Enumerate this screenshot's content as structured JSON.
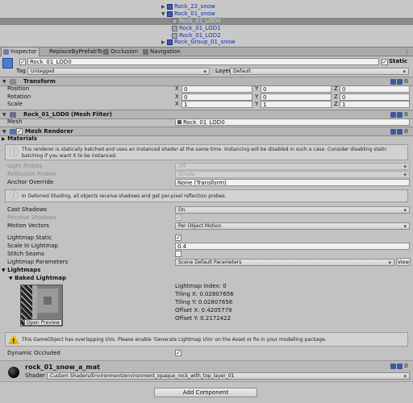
{
  "hierarchy": {
    "items": [
      {
        "label": "Rock_22_snow",
        "expanded": false,
        "selected": false
      },
      {
        "label": "Rock_01_snow",
        "expanded": true,
        "selected": false
      },
      {
        "label": "Rock_01_LOD0",
        "selected": true
      },
      {
        "label": "Rock_01_LOD1",
        "selected": false
      },
      {
        "label": "Rock_01_LOD2",
        "selected": false
      },
      {
        "label": "Rock_Group_01_snow",
        "expanded": false,
        "selected": false
      }
    ]
  },
  "tabs": [
    {
      "label": "Inspector",
      "active": true
    },
    {
      "label": "ReplaceByPrefabTool",
      "active": false
    },
    {
      "label": "Occlusion",
      "active": false
    },
    {
      "label": "Navigation",
      "active": false
    }
  ],
  "object": {
    "name": "Rock_01_LOD0",
    "static_label": "Static",
    "tag_label": "Tag",
    "tag_value": "Untagged",
    "layer_label": "Layer",
    "layer_value": "Default"
  },
  "transform": {
    "title": "Transform",
    "rows": [
      {
        "label": "Position",
        "x": "0",
        "y": "0",
        "z": "0"
      },
      {
        "label": "Rotation",
        "x": "0",
        "y": "0",
        "z": "0"
      },
      {
        "label": "Scale",
        "x": "1",
        "y": "1",
        "z": "1"
      }
    ],
    "axis_x": "X",
    "axis_y": "Y",
    "axis_z": "Z"
  },
  "mesh_filter": {
    "title": "Rock_01_LOD0 (Mesh Filter)",
    "mesh_label": "Mesh",
    "mesh_value": "Rock_01_LOD0"
  },
  "mesh_renderer": {
    "title": "Mesh Renderer",
    "materials_label": "Materials",
    "static_batch_help": "This renderer is statically batched and uses an instanced shader at the same time. Instancing will be disabled in such a case. Consider disabling static batching if you want it to be instanced.",
    "light_probes_label": "Light Probes",
    "light_probes_value": "Off",
    "reflection_probes_label": "Reflection Probes",
    "reflection_probes_value": "Simple",
    "anchor_override_label": "Anchor Override",
    "anchor_override_value": "None (Transform)",
    "deferred_help": "In Deferred Shading, all objects receive shadows and get per-pixel reflection probes.",
    "cast_shadows_label": "Cast Shadows",
    "cast_shadows_value": "On",
    "receive_shadows_label": "Receive Shadows",
    "motion_vectors_label": "Motion Vectors",
    "motion_vectors_value": "Per Object Motion",
    "lightmap_static_label": "Lightmap Static",
    "scale_in_lightmap_label": "Scale In Lightmap",
    "scale_in_lightmap_value": "0.4",
    "stitch_seams_label": "Stitch Seams",
    "lightmap_parameters_label": "Lightmap Parameters",
    "lightmap_parameters_value": "Scene Default Parameters",
    "view_button": "View",
    "lightmaps_label": "Lightmaps",
    "baked_lightmap_label": "Baked Lightmap",
    "open_preview": "Open Preview",
    "lightmap_index": "Lightmap Index: 0",
    "tiling_x": "Tiling X: 0.02807656",
    "tiling_y": "Tiling Y: 0.02807656",
    "offset_x": "Offset X: 0.4205779",
    "offset_y": "Offset Y: 0.2172422",
    "uv_warning": "This GameObject has overlapping UVs. Please enable 'Generate Lightmap UVs' on the Asset or fix in your modelling package.",
    "dynamic_occluded_label": "Dynamic Occluded"
  },
  "material": {
    "name": "rock_01_snow_a_mat",
    "shader_label": "Shader",
    "shader_value": "Custom Shaders/Environment/environment_opaque_rock_with_top_layer_01"
  },
  "add_component": "Add Component",
  "colors": {
    "panel": "#c2c2c2",
    "selection": "#8a8a8a",
    "hierarchy_text": "#0c2fb4",
    "warning": "#e6b400"
  },
  "icons": [
    "cube-icon",
    "fold-arrow-icon",
    "book-help-icon",
    "settings-icon",
    "info-icon",
    "warning-icon",
    "material-sphere-icon",
    "checkbox-icon"
  ]
}
